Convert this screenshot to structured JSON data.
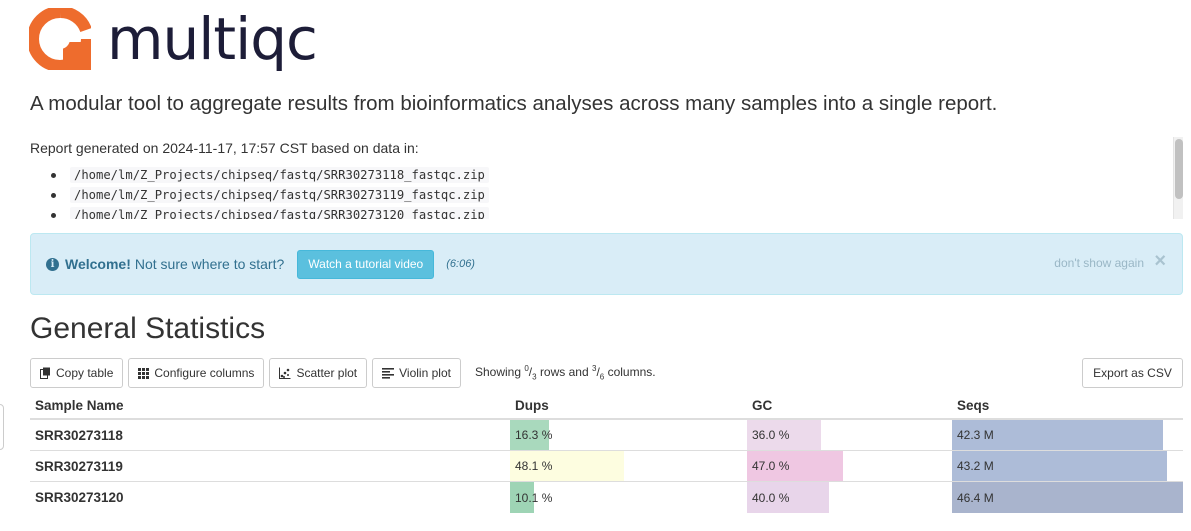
{
  "brand": {
    "logo_text": "multiqc",
    "logo_color": "#ee6c2d",
    "tagline": "A modular tool to aggregate results from bioinformatics analyses across many samples into a single report."
  },
  "report": {
    "generated_text": "Report generated on 2024-11-17, 17:57 CST based on data in:",
    "files": [
      "/home/lm/Z_Projects/chipseq/fastq/SRR30273118_fastqc.zip",
      "/home/lm/Z_Projects/chipseq/fastq/SRR30273119_fastqc.zip",
      "/home/lm/Z_Projects/chipseq/fastq/SRR30273120_fastqc.zip"
    ]
  },
  "welcome": {
    "icon": "info-circle-icon",
    "strong": "Welcome!",
    "text": "Not sure where to start?",
    "button_label": "Watch a tutorial video",
    "duration": "(6:06)",
    "dismiss_label": "don't show again",
    "close_glyph": "×"
  },
  "general_stats": {
    "title": "General Statistics",
    "toolbar": {
      "copy_label": "Copy table",
      "configure_label": "Configure columns",
      "scatter_label": "Scatter plot",
      "violin_label": "Violin plot",
      "showing_prefix": "Showing",
      "rows_num": "0",
      "rows_den": "3",
      "rows_mid": "rows and",
      "cols_num": "3",
      "cols_den": "6",
      "cols_suffix": "columns.",
      "export_label": "Export as CSV"
    },
    "columns": [
      "Sample Name",
      "Dups",
      "GC",
      "Seqs"
    ],
    "rows": [
      {
        "sample": "SRR30273118",
        "dups": "16.3 %",
        "dups_fill": 0.163,
        "dups_color": "#a9d9bd",
        "gc": "36.0 %",
        "gc_fill": 0.36,
        "gc_color": "#ecdaeb",
        "seqs": "42.3 M",
        "seqs_fill": 0.912,
        "seqs_color": "#adbcd8"
      },
      {
        "sample": "SRR30273119",
        "dups": "48.1 %",
        "dups_fill": 0.481,
        "dups_color": "#fdfde0",
        "gc": "47.0 %",
        "gc_fill": 0.47,
        "gc_color": "#efc7e2",
        "seqs": "43.2 M",
        "seqs_fill": 0.931,
        "seqs_color": "#adbcd8"
      },
      {
        "sample": "SRR30273120",
        "dups": "10.1 %",
        "dups_fill": 0.101,
        "dups_color": "#9ed4b5",
        "gc": "40.0 %",
        "gc_fill": 0.4,
        "gc_color": "#e8d5ea",
        "seqs": "46.4 M",
        "seqs_fill": 1.0,
        "seqs_color": "#a9b4cd"
      }
    ]
  }
}
